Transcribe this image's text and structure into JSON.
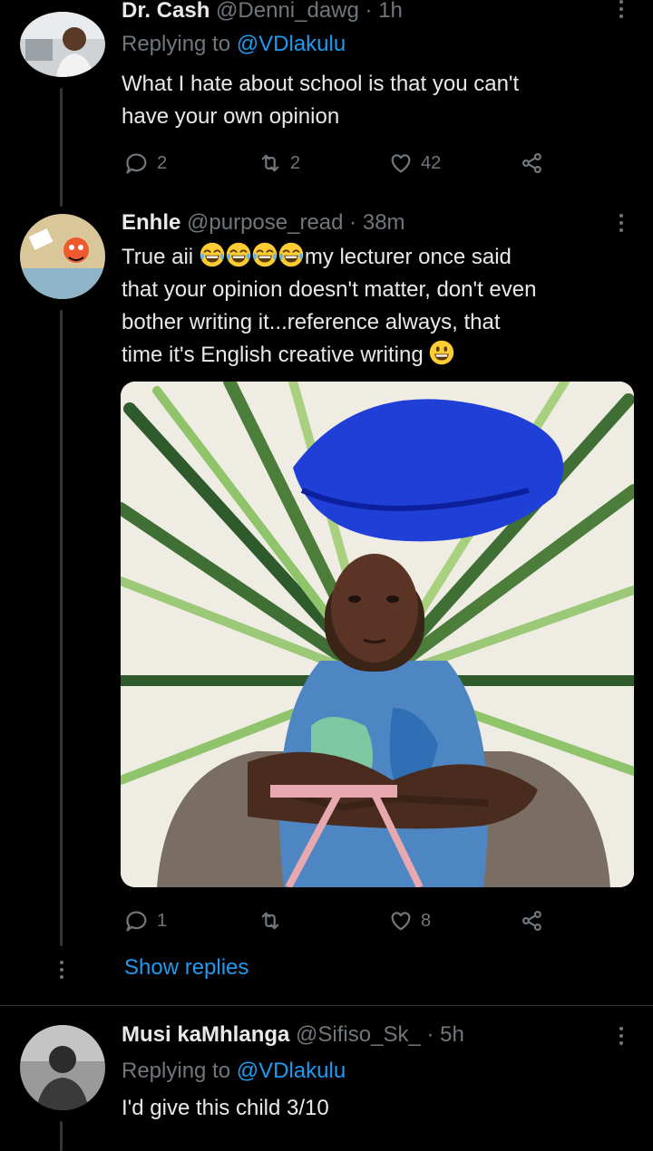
{
  "tweets": [
    {
      "display_name": "Dr. Cash",
      "handle": "@Denni_dawg",
      "separator": "·",
      "time": "1h",
      "replying_prefix": "Replying to",
      "replying_to": "@VDlakulu",
      "text_line1": "What I hate about school is that you can't",
      "text_line2": "have your own opinion",
      "replies": "2",
      "retweets": "2",
      "likes": "42"
    },
    {
      "display_name": "Enhle",
      "handle": "@purpose_read",
      "separator": "·",
      "time": "38m",
      "text_line1_prefix": "True aii ",
      "text_line1_suffix": "my lecturer once said",
      "text_line2": "that your opinion doesn't matter, don't even",
      "text_line3": "bother writing it...reference always, that",
      "text_line4": "time it's English creative writing ",
      "replies": "1",
      "likes": "8",
      "show_replies": "Show replies"
    },
    {
      "display_name": "Musi kaMhlanga",
      "handle": "@Sifiso_Sk_",
      "separator": "·",
      "time": "5h",
      "replying_prefix": "Replying to",
      "replying_to": "@VDlakulu",
      "text_line1": "I'd give this child 3/10"
    }
  ],
  "icons": {
    "reply": "speech-bubble-icon",
    "retweet": "retweet-icon",
    "like": "heart-icon",
    "share": "share-icon",
    "more": "vertical-ellipsis-icon",
    "emoji_laugh": "face-with-tears-of-joy",
    "emoji_smile": "grinning-face"
  },
  "colors": {
    "background": "#000000",
    "text": "#e7e9ea",
    "muted": "#71767b",
    "link": "#1d9bf0"
  }
}
